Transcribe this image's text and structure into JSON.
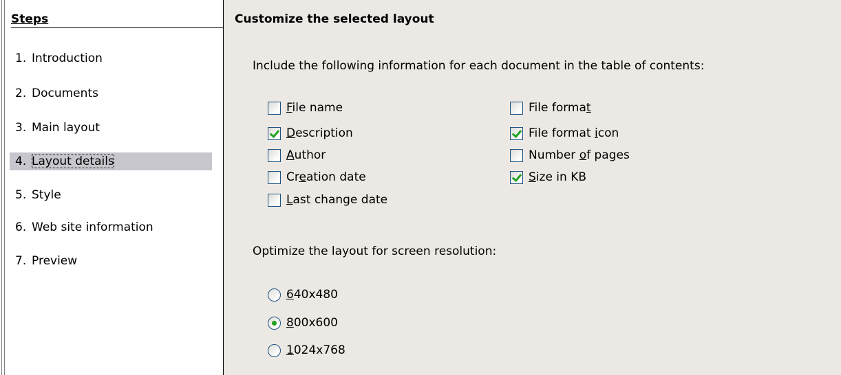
{
  "steps": {
    "heading_before": "Ste",
    "heading_mnemonic": "p",
    "heading_after": "s",
    "items": [
      {
        "number": "1.",
        "label": "Introduction"
      },
      {
        "number": "2.",
        "label": "Documents"
      },
      {
        "number": "3.",
        "label": "Main layout"
      },
      {
        "number": "4.",
        "label": "Layout details",
        "selected": true
      },
      {
        "number": "5.",
        "label": "Style"
      },
      {
        "number": "6.",
        "label": "Web site information"
      },
      {
        "number": "7.",
        "label": "Preview"
      }
    ]
  },
  "main": {
    "title": "Customize the selected layout",
    "include_instruction": "Include the following information for each document in the table of contents:",
    "checkboxes": {
      "file_name": {
        "before": "",
        "mnemonic": "F",
        "after": "ile name",
        "checked": false
      },
      "description": {
        "before": "",
        "mnemonic": "D",
        "after": "escription",
        "checked": true
      },
      "author": {
        "before": "",
        "mnemonic": "A",
        "after": "uthor",
        "checked": false
      },
      "creation_date": {
        "before": "Cr",
        "mnemonic": "e",
        "after": "ation date",
        "checked": false
      },
      "last_change_date": {
        "before": "",
        "mnemonic": "L",
        "after": "ast change date",
        "checked": false
      },
      "file_format": {
        "before": "File forma",
        "mnemonic": "t",
        "after": "",
        "checked": false
      },
      "file_format_icon": {
        "before": "File format ",
        "mnemonic": "i",
        "after": "con",
        "checked": true
      },
      "number_of_pages": {
        "before": "Number ",
        "mnemonic": "o",
        "after": "f pages",
        "checked": false
      },
      "size_in_kb": {
        "before": "",
        "mnemonic": "S",
        "after": "ize in KB",
        "checked": true
      }
    },
    "resolution_instruction": "Optimize the layout for screen resolution:",
    "resolutions": {
      "r640": {
        "mnemonic": "6",
        "after": "40x480",
        "selected": false
      },
      "r800": {
        "mnemonic": "8",
        "after": "00x600",
        "selected": true
      },
      "r1024": {
        "mnemonic": "1",
        "after": "024x768",
        "selected": false
      }
    }
  },
  "colors": {
    "selected_step_bg": "#c6c6cc",
    "panel_bg": "#ece9e4",
    "check_green": "#21a121",
    "control_border": "#1c5180"
  }
}
